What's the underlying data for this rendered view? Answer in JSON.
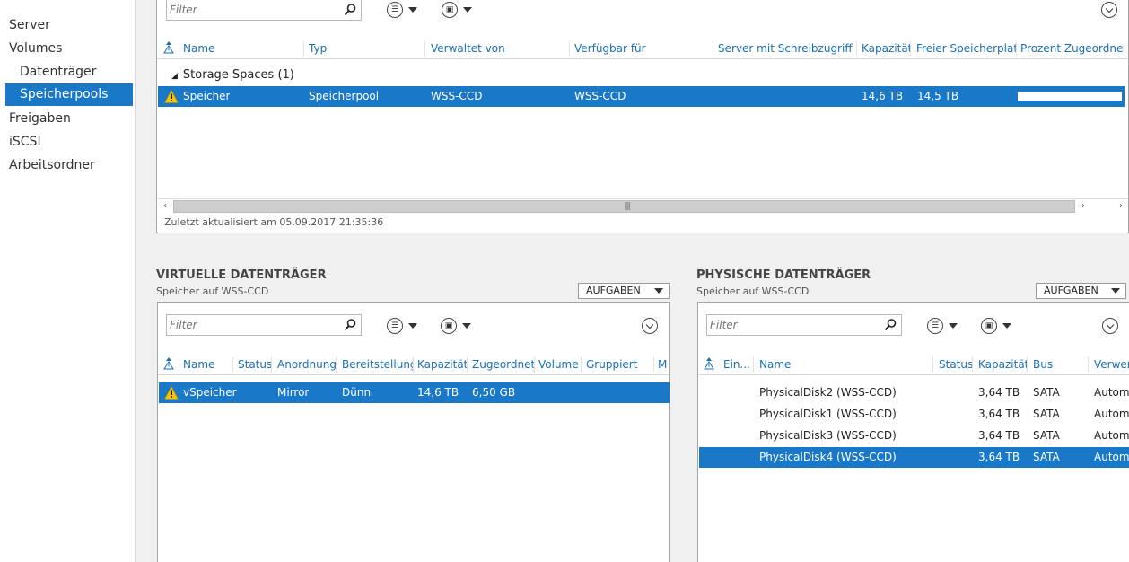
{
  "sidebar": {
    "items": [
      {
        "label": "Server"
      },
      {
        "label": "Volumes"
      },
      {
        "label": "Datenträger"
      },
      {
        "label": "Speicherpools"
      },
      {
        "label": "Freigaben"
      },
      {
        "label": "iSCSI"
      },
      {
        "label": "Arbeitsordner"
      }
    ]
  },
  "pools": {
    "filter_placeholder": "Filter",
    "columns": [
      "Name",
      "Typ",
      "Verwaltet von",
      "Verfügbar für",
      "Server mit Schreibzugriff",
      "Kapazität",
      "Freier Speicherplatz",
      "Prozent Zugeordnet"
    ],
    "group_label": "Storage Spaces (1)",
    "rows": [
      {
        "name": "Speicher",
        "typ": "Speicherpool",
        "verwaltet": "WSS-CCD",
        "verfuegbar": "WSS-CCD",
        "server": "",
        "kapazitaet": "14,6 TB",
        "frei": "14,5 TB",
        "prozent": 0.0
      }
    ],
    "status_text": "Zuletzt aktualisiert am 05.09.2017 21:35:36"
  },
  "virtual": {
    "title": "VIRTUELLE DATENTRÄGER",
    "subtitle": "Speicher auf WSS-CCD",
    "tasks_label": "AUFGABEN",
    "filter_placeholder": "Filter",
    "columns": [
      "Name",
      "Status",
      "Anordnung",
      "Bereitstellung",
      "Kapazität",
      "Zugeordnet",
      "Volume",
      "Gruppiert",
      "M"
    ],
    "rows": [
      {
        "name": "vSpeicher",
        "status": "",
        "anordnung": "Mirror",
        "bereitstellung": "Dünn",
        "kapazitaet": "14,6 TB",
        "zugeordnet": "6,50 GB"
      }
    ]
  },
  "physical": {
    "title": "PHYSISCHE DATENTRÄGER",
    "subtitle": "Speicher auf WSS-CCD",
    "tasks_label": "AUFGABEN",
    "filter_placeholder": "Filter",
    "columns": [
      "Ein...",
      "Name",
      "Status",
      "Kapazität",
      "Bus",
      "Verwer"
    ],
    "rows": [
      {
        "name": "PhysicalDisk2 (WSS-CCD)",
        "kapazitaet": "3,64 TB",
        "bus": "SATA",
        "verwendung": "Autom"
      },
      {
        "name": "PhysicalDisk1 (WSS-CCD)",
        "kapazitaet": "3,64 TB",
        "bus": "SATA",
        "verwendung": "Autom"
      },
      {
        "name": "PhysicalDisk3 (WSS-CCD)",
        "kapazitaet": "3,64 TB",
        "bus": "SATA",
        "verwendung": "Autom"
      },
      {
        "name": "PhysicalDisk4 (WSS-CCD)",
        "kapazitaet": "3,64 TB",
        "bus": "SATA",
        "verwendung": "Autom"
      }
    ]
  },
  "icons": {
    "search": "search-icon",
    "warning": "warning-icon",
    "list": "list-view-icon",
    "save": "save-icon",
    "expand": "expand-icon"
  },
  "colors": {
    "selection": "#1979c8",
    "header_text": "#1a6fb5",
    "warning": "#f5c400"
  }
}
